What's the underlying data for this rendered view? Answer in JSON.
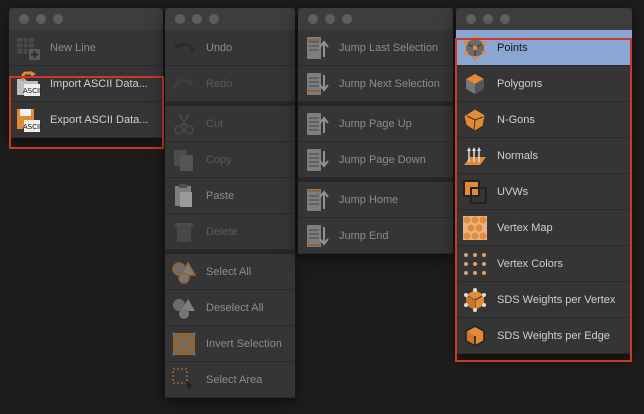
{
  "window_file": {
    "items": [
      {
        "label": "New Line",
        "icon": "new-line-icon"
      },
      {
        "label": "Import ASCII Data...",
        "icon": "import-ascii-icon"
      },
      {
        "label": "Export ASCII Data...",
        "icon": "export-ascii-icon"
      }
    ]
  },
  "window_edit": {
    "items": [
      {
        "label": "Undo",
        "icon": "undo-icon"
      },
      {
        "label": "Redo",
        "icon": "redo-icon"
      },
      {
        "label": "Cut",
        "icon": "cut-icon"
      },
      {
        "label": "Copy",
        "icon": "copy-icon"
      },
      {
        "label": "Paste",
        "icon": "paste-icon"
      },
      {
        "label": "Delete",
        "icon": "delete-icon"
      },
      {
        "label": "Select All",
        "icon": "select-all-icon"
      },
      {
        "label": "Deselect All",
        "icon": "deselect-all-icon"
      },
      {
        "label": "Invert Selection",
        "icon": "invert-selection-icon"
      },
      {
        "label": "Select Area",
        "icon": "select-area-icon"
      }
    ]
  },
  "window_jump": {
    "items": [
      {
        "label": "Jump Last Selection",
        "icon": "jump-last-selection-icon"
      },
      {
        "label": "Jump Next Selection",
        "icon": "jump-next-selection-icon"
      },
      {
        "label": "Jump Page Up",
        "icon": "jump-page-up-icon"
      },
      {
        "label": "Jump Page Down",
        "icon": "jump-page-down-icon"
      },
      {
        "label": "Jump Home",
        "icon": "jump-home-icon"
      },
      {
        "label": "Jump End",
        "icon": "jump-end-icon"
      }
    ]
  },
  "window_modes": {
    "items": [
      {
        "label": "Points",
        "icon": "points-mode-icon"
      },
      {
        "label": "Polygons",
        "icon": "polygons-mode-icon"
      },
      {
        "label": "N-Gons",
        "icon": "ngons-icon"
      },
      {
        "label": "Normals",
        "icon": "normals-icon"
      },
      {
        "label": "UVWs",
        "icon": "uvws-icon"
      },
      {
        "label": "Vertex Map",
        "icon": "vertex-map-icon"
      },
      {
        "label": "Vertex Colors",
        "icon": "vertex-colors-icon"
      },
      {
        "label": "SDS Weights per Vertex",
        "icon": "sds-weights-vertex-icon"
      },
      {
        "label": "SDS Weights per Edge",
        "icon": "sds-weights-edge-icon"
      }
    ]
  },
  "colors": {
    "selection_outline": "#c9382b",
    "highlight": "#8aa6d2",
    "accent_orange": "#e28a35"
  }
}
